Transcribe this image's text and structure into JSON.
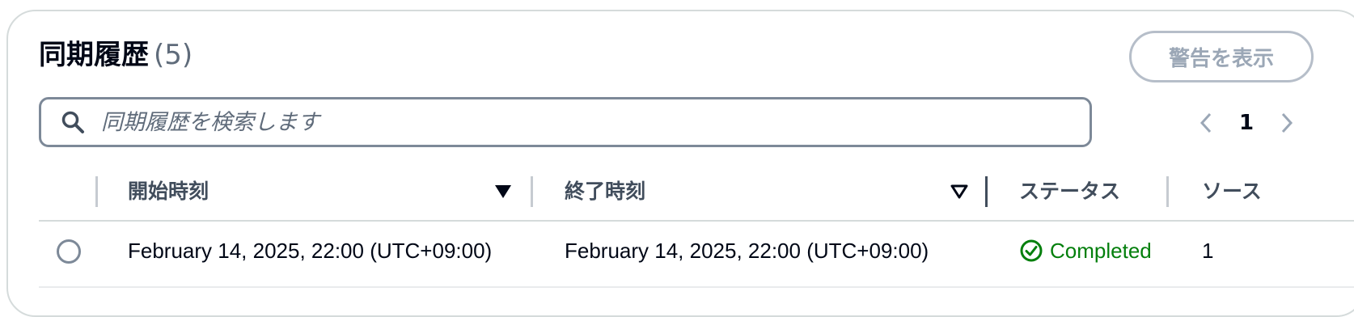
{
  "header": {
    "title": "同期履歴",
    "count": "(5)",
    "show_warnings_label": "警告を表示"
  },
  "search": {
    "placeholder": "同期履歴を検索します",
    "icon": "search-icon"
  },
  "pagination": {
    "current_page": "1",
    "prev_icon": "chevron-left-icon",
    "next_icon": "chevron-right-icon"
  },
  "table": {
    "columns": [
      {
        "label": "開始時刻",
        "sort": "descending"
      },
      {
        "label": "終了時刻",
        "sort": "none"
      },
      {
        "label": "ステータス"
      },
      {
        "label": "ソース"
      }
    ],
    "rows": [
      {
        "start_time": "February 14, 2025, 22:00 (UTC+09:00)",
        "end_time": "February 14, 2025, 22:00 (UTC+09:00)",
        "status": "Completed",
        "status_icon": "check-circle-icon",
        "source": "1"
      }
    ]
  },
  "colors": {
    "success": "#037f0c",
    "border": "#d5dbdb",
    "text_secondary": "#414d5c"
  }
}
